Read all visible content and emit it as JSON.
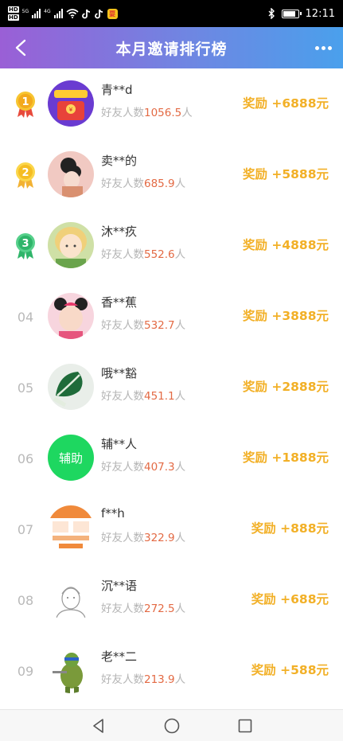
{
  "status_bar": {
    "hd1": "HD",
    "hd2": "HD",
    "net1": "5G",
    "net2": "4G",
    "time": "12:11",
    "app_badge": "耍"
  },
  "header": {
    "title": "本月邀请排行榜"
  },
  "colors": {
    "accent_reward": "#f2b027",
    "number_highlight": "#e36a44",
    "header_gradient": [
      "#9a5fd6",
      "#4aa0ec"
    ]
  },
  "list": {
    "items": [
      {
        "rank": "",
        "medal": "1",
        "name": "青**d",
        "prefix": "好友人数",
        "count": "1056.5",
        "suffix": "人",
        "reward": "奖励 +6888元",
        "avatar": "red-envelope-avatar"
      },
      {
        "rank": "",
        "medal": "2",
        "name": "卖**的",
        "prefix": "好友人数",
        "count": "685.9",
        "suffix": "人",
        "reward": "奖励 +5888元",
        "avatar": "woman-avatar"
      },
      {
        "rank": "",
        "medal": "3",
        "name": "沐**疚",
        "prefix": "好友人数",
        "count": "552.6",
        "suffix": "人",
        "reward": "奖励 +4888元",
        "avatar": "anime-boy-avatar"
      },
      {
        "rank": "04",
        "medal": "",
        "name": "香**蕉",
        "prefix": "好友人数",
        "count": "532.7",
        "suffix": "人",
        "reward": "奖励 +3888元",
        "avatar": "child-avatar"
      },
      {
        "rank": "05",
        "medal": "",
        "name": "哦**豁",
        "prefix": "好友人数",
        "count": "451.1",
        "suffix": "人",
        "reward": "奖励 +2888元",
        "avatar": "cabbage-avatar"
      },
      {
        "rank": "06",
        "medal": "",
        "name": "辅**人",
        "prefix": "好友人数",
        "count": "407.3",
        "suffix": "人",
        "reward": "奖励 +1888元",
        "avatar": "assist-avatar",
        "avatar_text": "辅助"
      },
      {
        "rank": "07",
        "medal": "",
        "name": "f**h",
        "prefix": "好友人数",
        "count": "322.9",
        "suffix": "人",
        "reward": "奖励 +888元",
        "avatar": "screenshot-avatar"
      },
      {
        "rank": "08",
        "medal": "",
        "name": "沉**语",
        "prefix": "好友人数",
        "count": "272.5",
        "suffix": "人",
        "reward": "奖励 +688元",
        "avatar": "sketch-avatar"
      },
      {
        "rank": "09",
        "medal": "",
        "name": "老**二",
        "prefix": "好友人数",
        "count": "213.9",
        "suffix": "人",
        "reward": "奖励 +588元",
        "avatar": "turtle-avatar"
      }
    ]
  }
}
